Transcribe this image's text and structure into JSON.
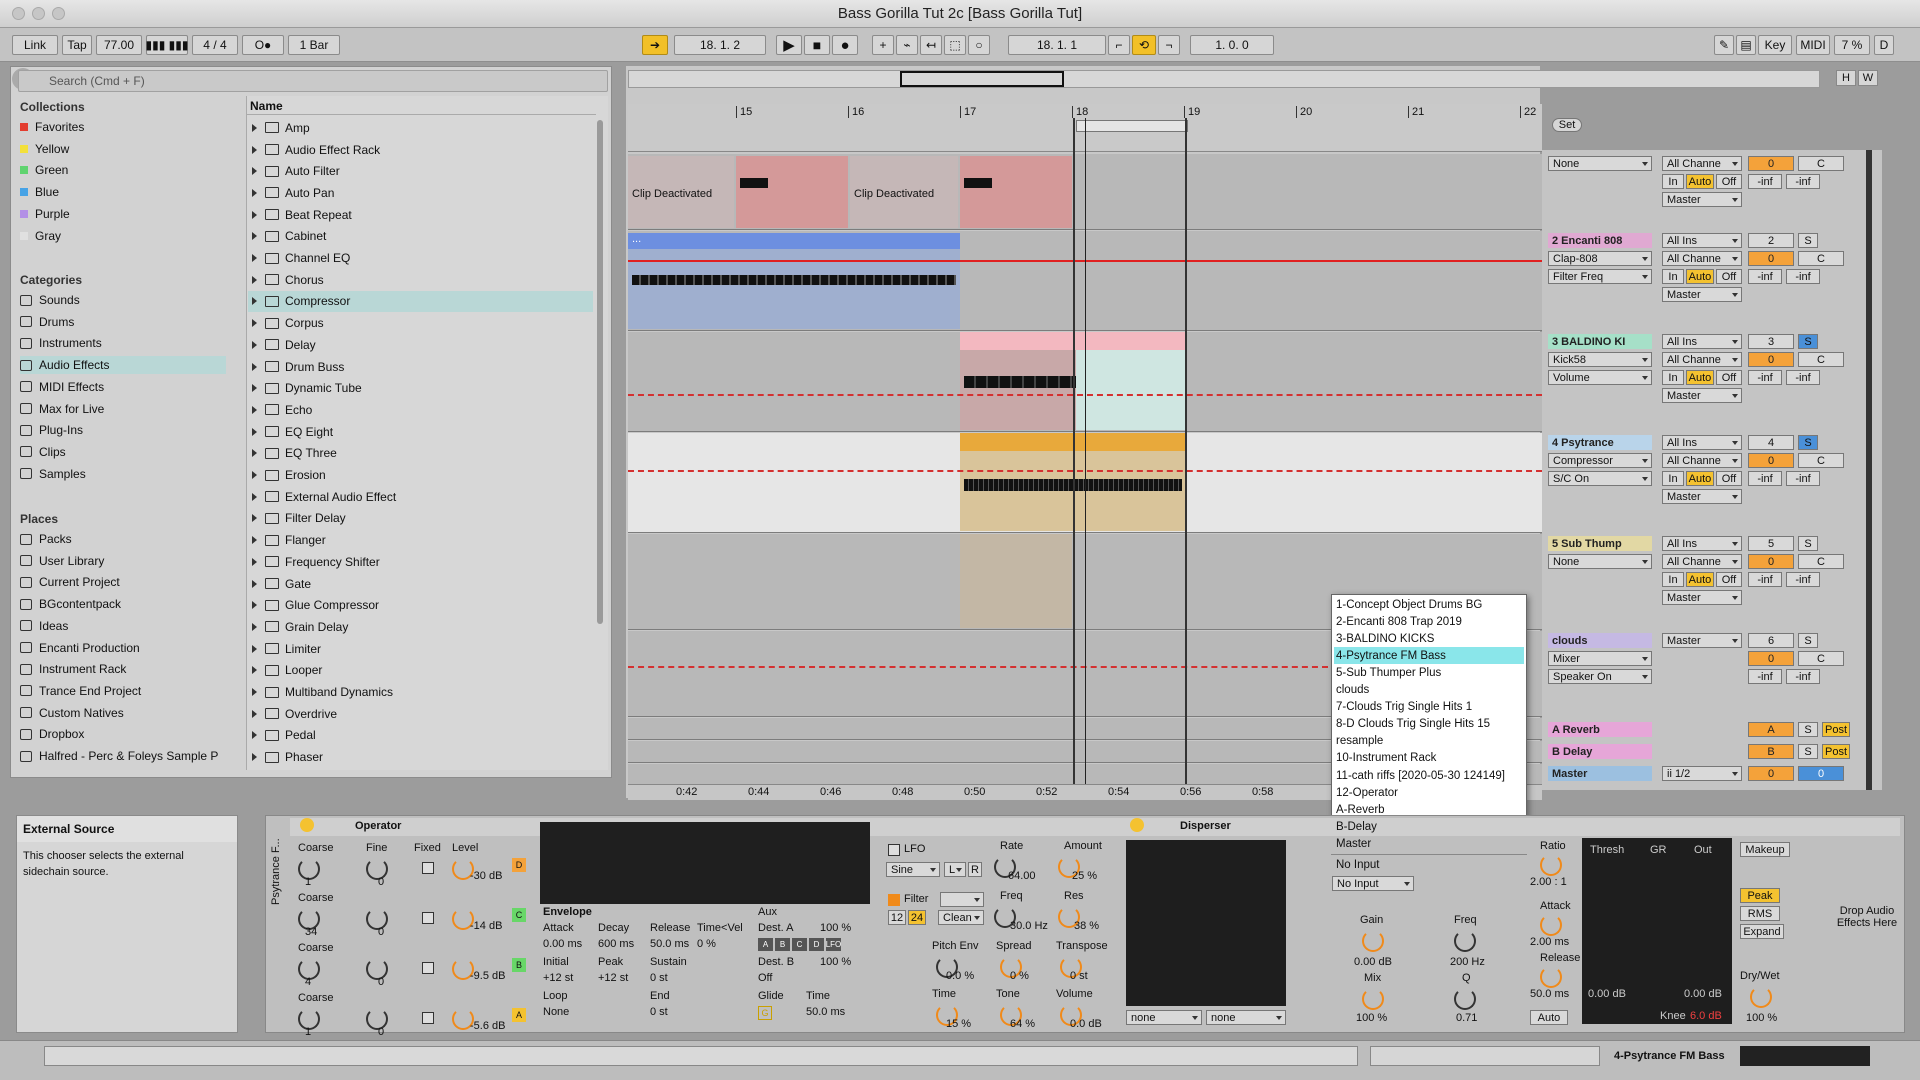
{
  "window": {
    "title": "Bass Gorilla Tut 2c  [Bass Gorilla Tut]"
  },
  "transport": {
    "link": "Link",
    "tap": "Tap",
    "tempo": "77.00",
    "sig_num": "4",
    "sig_den": "4",
    "quant": "1 Bar",
    "position": "18.   1.   2",
    "loop_start": "18.   1.   1",
    "loop_len": "1.   0.   0",
    "key": "Key",
    "midi": "MIDI",
    "cpu": "7 %",
    "d": "D",
    "oo": "O●"
  },
  "browser": {
    "search_placeholder": "Search (Cmd + F)",
    "collections_title": "Collections",
    "collections": [
      {
        "label": "Favorites",
        "color": "#e33d2f"
      },
      {
        "label": "Yellow",
        "color": "#f3e03a"
      },
      {
        "label": "Green",
        "color": "#5fd36f"
      },
      {
        "label": "Blue",
        "color": "#47a3e6"
      },
      {
        "label": "Purple",
        "color": "#b390e6"
      },
      {
        "label": "Gray",
        "color": "#e0e0e0"
      }
    ],
    "categories_title": "Categories",
    "categories": [
      "Sounds",
      "Drums",
      "Instruments",
      "Audio Effects",
      "MIDI Effects",
      "Max for Live",
      "Plug-Ins",
      "Clips",
      "Samples"
    ],
    "places_title": "Places",
    "places": [
      "Packs",
      "User Library",
      "Current Project",
      "BGcontentpack",
      "Ideas",
      "Encanti Production",
      "Instrument Rack",
      "Trance End Project",
      "Custom Natives",
      "Dropbox",
      "Halfred - Perc & Foleys Sample P"
    ],
    "name_header": "Name",
    "items": [
      "Amp",
      "Audio Effect Rack",
      "Auto Filter",
      "Auto Pan",
      "Beat Repeat",
      "Cabinet",
      "Channel EQ",
      "Chorus",
      "Compressor",
      "Corpus",
      "Delay",
      "Drum Buss",
      "Dynamic Tube",
      "Echo",
      "EQ Eight",
      "EQ Three",
      "Erosion",
      "External Audio Effect",
      "Filter Delay",
      "Flanger",
      "Frequency Shifter",
      "Gate",
      "Glue Compressor",
      "Grain Delay",
      "Limiter",
      "Looper",
      "Multiband Dynamics",
      "Overdrive",
      "Pedal",
      "Phaser"
    ]
  },
  "arrangement": {
    "bars": [
      "15",
      "16",
      "17",
      "18",
      "19",
      "20",
      "21",
      "22"
    ],
    "times": [
      "0:42",
      "0:44",
      "0:46",
      "0:48",
      "0:50",
      "0:52",
      "0:54",
      "0:56",
      "0:58"
    ],
    "clip_deactivated": "Clip Deactivated",
    "set": "Set",
    "ellipsis": "..."
  },
  "tracks": [
    {
      "name": "",
      "sel": "None",
      "num": "",
      "vol": "0",
      "pan": "C",
      "in": "In",
      "auto": "Auto",
      "off": "Off",
      "inf1": "-inf",
      "inf2": "-inf",
      "out": "Master",
      "ins": "",
      "chan": "All Channe"
    },
    {
      "name": "2 Encanti 808",
      "dev": "Clap-808",
      "param": "Filter Freq",
      "num": "2",
      "vol": "0",
      "pan": "C",
      "in": "In",
      "auto": "Auto",
      "off": "Off",
      "inf1": "-inf",
      "inf2": "-inf",
      "out": "Master",
      "ins": "All Ins",
      "chan": "All Channe",
      "s": "S"
    },
    {
      "name": "3 BALDINO KI",
      "dev": "Kick58",
      "param": "Volume",
      "num": "3",
      "vol": "0",
      "pan": "C",
      "in": "In",
      "auto": "Auto",
      "off": "Off",
      "inf1": "-inf",
      "inf2": "-inf",
      "out": "Master",
      "ins": "All Ins",
      "chan": "All Channe",
      "s": "S"
    },
    {
      "name": "4 Psytrance",
      "dev": "Compressor",
      "param": "S/C On",
      "num": "4",
      "vol": "0",
      "pan": "C",
      "in": "In",
      "auto": "Auto",
      "off": "Off",
      "inf1": "-inf",
      "inf2": "-inf",
      "out": "Master",
      "ins": "All Ins",
      "chan": "All Channe",
      "s": "S"
    },
    {
      "name": "5 Sub Thump",
      "dev": "None",
      "param": "",
      "num": "5",
      "vol": "0",
      "pan": "C",
      "in": "In",
      "auto": "Auto",
      "off": "Off",
      "inf1": "-inf",
      "inf2": "-inf",
      "out": "Master",
      "ins": "All Ins",
      "chan": "All Channe",
      "s": "S"
    },
    {
      "name": "clouds",
      "dev": "Mixer",
      "param": "Speaker On",
      "num": "6",
      "vol": "0",
      "pan": "C",
      "inf1": "-inf",
      "inf2": "-inf",
      "out": "Master",
      "s": "S"
    }
  ],
  "returns": [
    {
      "name": "A Reverb",
      "letter": "A",
      "s": "S",
      "post": "Post"
    },
    {
      "name": "B Delay",
      "letter": "B",
      "s": "S",
      "post": "Post"
    },
    {
      "name": "Master",
      "letter": "0",
      "s": "",
      "post": "",
      "out": "ii 1/2",
      "val": "0"
    }
  ],
  "popup": {
    "items": [
      "1-Concept Object Drums BG",
      "2-Encanti 808 Trap 2019",
      "3-BALDINO KICKS",
      "4-Psytrance FM Bass",
      "5-Sub Thumper Plus",
      "clouds",
      "7-Clouds Trig Single Hits 1",
      "8-D Clouds Trig Single Hits 15",
      "resample",
      "10-Instrument Rack",
      "11-cath riffs [2020-05-30 124149]",
      "12-Operator",
      "A-Reverb",
      "B-Delay",
      "Master"
    ],
    "highlight": 3,
    "no_input": "No Input"
  },
  "info": {
    "title": "External Source",
    "text": "This chooser selects the external sidechain source."
  },
  "operator": {
    "title": "Operator",
    "rack": "Psytrance F...",
    "col_coarse": "Coarse",
    "col_fine": "Fine",
    "col_fixed": "Fixed",
    "col_level": "Level",
    "ops": [
      {
        "coarse": "1",
        "fine": "0",
        "level": "-30 dB",
        "letter": "D"
      },
      {
        "coarse": "34",
        "fine": "0",
        "level": "-14 dB",
        "letter": "C"
      },
      {
        "coarse": "4",
        "fine": "0",
        "level": "-9.5 dB",
        "letter": "B"
      },
      {
        "coarse": "1",
        "fine": "0",
        "level": "-5.6 dB",
        "letter": "A"
      }
    ],
    "env": {
      "title": "Envelope",
      "attack": "Attack",
      "decay": "Decay",
      "release": "Release",
      "timevel": "Time<Vel",
      "attack_v": "0.00 ms",
      "decay_v": "600 ms",
      "release_v": "50.0 ms",
      "timevel_v": "0 %",
      "initial": "Initial",
      "peak": "Peak",
      "sustain": "Sustain",
      "initial_v": "+12 st",
      "peak_v": "+12 st",
      "sustain_v": "0 st",
      "loop": "Loop",
      "end": "End",
      "loop_v": "None",
      "end_v": "0 st"
    },
    "aux": {
      "title": "Aux",
      "desta": "Dest. A",
      "desta_v": "100 %",
      "destb": "Dest. B",
      "destb_v": "100 %",
      "off": "Off",
      "glide": "Glide",
      "time": "Time",
      "time_v": "50.0 ms",
      "g": "G",
      "letters": [
        "A",
        "B",
        "C",
        "D",
        "LFO"
      ]
    },
    "lfo": {
      "label": "LFO",
      "wave": "Sine",
      "l": "L",
      "r": "R",
      "rate": "Rate",
      "rate_v": "64.00",
      "amount": "Amount",
      "amount_v": "25 %"
    },
    "filter": {
      "label": "Filter",
      "type": "",
      "n12": "12",
      "n24": "24",
      "clean": "Clean",
      "freq": "Freq",
      "freq_v": "30.0 Hz",
      "res": "Res",
      "res_v": "38 %"
    },
    "pitch": {
      "pitchenv": "Pitch Env",
      "pitchenv_v": "0.0 %",
      "spread": "Spread",
      "spread_v": "0 %",
      "transpose": "Transpose",
      "transpose_v": "0 st",
      "time": "Time",
      "time_v": "15 %",
      "tone": "Tone",
      "tone_v": "64 %",
      "volume": "Volume",
      "volume_v": "0.0 dB"
    }
  },
  "disperser": {
    "title": "Disperser",
    "none1": "none",
    "none2": "none"
  },
  "compressor": {
    "noinput": "No Input",
    "gain": "Gain",
    "gain_v": "0.00 dB",
    "mix": "Mix",
    "mix_v": "100 %",
    "freq": "Freq",
    "freq_v": "200 Hz",
    "q": "Q",
    "q_v": "0.71",
    "ratio": "Ratio",
    "ratio_v": "2.00 : 1",
    "attack": "Attack",
    "attack_v": "2.00 ms",
    "release": "Release",
    "release_v": "50.0 ms",
    "auto": "Auto",
    "thresh": "Thresh",
    "gr": "GR",
    "out": "Out",
    "thresh_v": "0.00 dB",
    "out_v": "0.00 dB",
    "knee": "Knee",
    "knee_v": "6.0 dB",
    "makeup": "Makeup",
    "peak": "Peak",
    "rms": "RMS",
    "expand": "Expand",
    "drywet": "Dry/Wet",
    "drywet_v": "100 %"
  },
  "dropzone": "Drop Audio Effects Here",
  "status": {
    "track": "4-Psytrance FM Bass",
    "h": "H",
    "w": "W"
  }
}
